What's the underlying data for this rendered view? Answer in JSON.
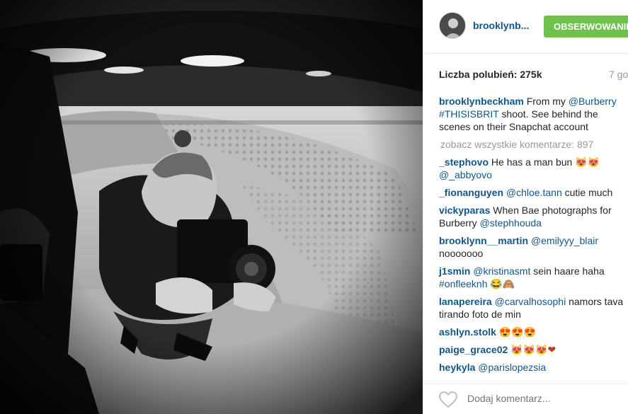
{
  "post": {
    "username": "brooklynb...",
    "follow_label": "OBSERWOWANIE",
    "likes": "Liczba polubień: 275k",
    "time_ago": "7 go",
    "view_all": "zobacz wszystkie komentarze: 897",
    "add_comment_placeholder": "Dodaj komentarz..."
  },
  "comments": [
    {
      "user": "brooklynbeckham",
      "parts": [
        " From my ",
        "@Burberry",
        " ",
        "#THISISBRIT",
        " shoot. See behind the scenes on their Snapchat account"
      ]
    },
    {
      "user": "_stephovo",
      "text": " He has a man bun ",
      "emoji": "😻😻",
      "mention": "@_abbyovo"
    },
    {
      "user": "_fionanguyen",
      "mention": "@chloe.tann",
      "text": " cutie much"
    },
    {
      "user": "vickyparas",
      "text": " When Bae photographs for Burberry ",
      "mention": "@stephhouda"
    },
    {
      "user": "brooklynn__martin",
      "mention": "@emilyyy_blair",
      "text": "nooooooo"
    },
    {
      "user": "j1smin",
      "mention": "@kristinasmt",
      "text": " sein haare haha ",
      "tag": "#onfleeknh",
      "emoji": "😂🙈"
    },
    {
      "user": "lanapereira",
      "mention": "@carvalhosophi",
      "text": " namors tava tirando foto de min"
    },
    {
      "user": "ashlyn.stolk",
      "emoji": "😍😍😍"
    },
    {
      "user": "paige_grace02",
      "emoji": "😻😻😻❤"
    },
    {
      "user": "heykyla",
      "mention": "@parislopezsia"
    }
  ],
  "colors": {
    "link": "#125688",
    "follow": "#70c050",
    "muted": "#999999"
  },
  "icons": {
    "like": "heart-icon"
  }
}
